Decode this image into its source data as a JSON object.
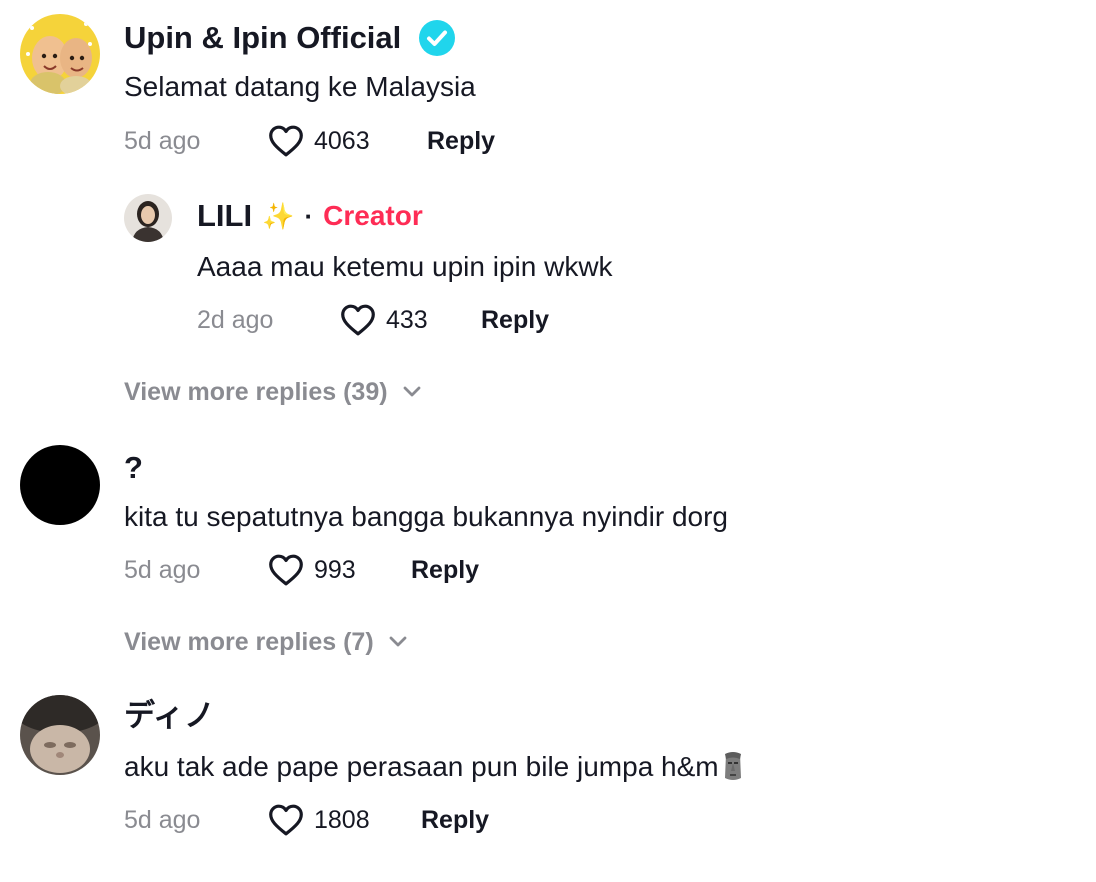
{
  "comments": [
    {
      "username": "Upin & Ipin Official",
      "verified": true,
      "text": "Selamat datang ke Malaysia",
      "time": "5d ago",
      "likes": "4063",
      "reply_label": "Reply"
    },
    {
      "username": "?",
      "text": "kita tu sepatutnya bangga bukannya nyindir dorg",
      "time": "5d ago",
      "likes": "993",
      "reply_label": "Reply"
    },
    {
      "username": "ディノ",
      "text": "aku tak ade pape perasaan pun bile jumpa h&m",
      "text_emoji": "moai-emoji",
      "time": "5d ago",
      "likes": "1808",
      "reply_label": "Reply"
    }
  ],
  "reply": {
    "username": "LILI",
    "username_emoji": "✨",
    "separator": "·",
    "badge": "Creator",
    "text": "Aaaa mau ketemu upin ipin wkwk",
    "time": "2d ago",
    "likes": "433",
    "reply_label": "Reply"
  },
  "view_more": [
    "View more replies (39)",
    "View more replies (7)"
  ],
  "colors": {
    "verified_badge": "#20d5ec",
    "creator_badge": "#fe2c55",
    "muted_text": "#8a8b91",
    "primary_text": "#161823"
  }
}
